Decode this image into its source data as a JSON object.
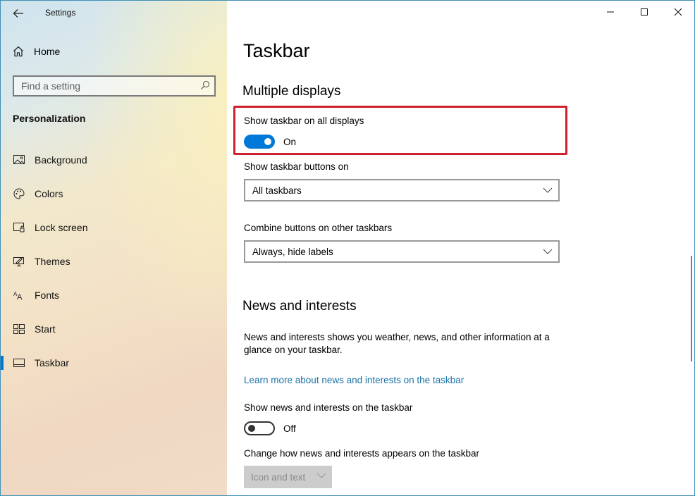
{
  "window": {
    "title": "Settings",
    "controls": {
      "minimize": "minimize",
      "maximize": "maximize",
      "close": "close"
    }
  },
  "sidebar": {
    "home_label": "Home",
    "search": {
      "placeholder": "Find a setting",
      "value": ""
    },
    "section_label": "Personalization",
    "items": [
      {
        "label": "Background",
        "icon": "picture-icon"
      },
      {
        "label": "Colors",
        "icon": "palette-icon"
      },
      {
        "label": "Lock screen",
        "icon": "lock-screen-icon"
      },
      {
        "label": "Themes",
        "icon": "themes-icon"
      },
      {
        "label": "Fonts",
        "icon": "fonts-icon"
      },
      {
        "label": "Start",
        "icon": "start-icon"
      },
      {
        "label": "Taskbar",
        "icon": "taskbar-icon",
        "active": true
      }
    ]
  },
  "main": {
    "page_title": "Taskbar",
    "multiple_displays": {
      "heading": "Multiple displays",
      "show_on_all": {
        "label": "Show taskbar on all displays",
        "state": "On",
        "value": true
      },
      "buttons_on": {
        "label": "Show taskbar buttons on",
        "selected": "All taskbars"
      },
      "combine_other": {
        "label": "Combine buttons on other taskbars",
        "selected": "Always, hide labels"
      }
    },
    "news": {
      "heading": "News and interests",
      "description": "News and interests shows you weather, news, and other information at a glance on your taskbar.",
      "link": "Learn more about news and interests on the taskbar",
      "show_toggle": {
        "label": "Show news and interests on the taskbar",
        "state": "Off",
        "value": false
      },
      "appearance": {
        "label": "Change how news and interests appears on the taskbar",
        "selected": "Icon and text",
        "disabled": true
      }
    }
  },
  "colors": {
    "accent": "#0078d7",
    "highlight": "#d0222e",
    "link": "#1a73a8"
  }
}
